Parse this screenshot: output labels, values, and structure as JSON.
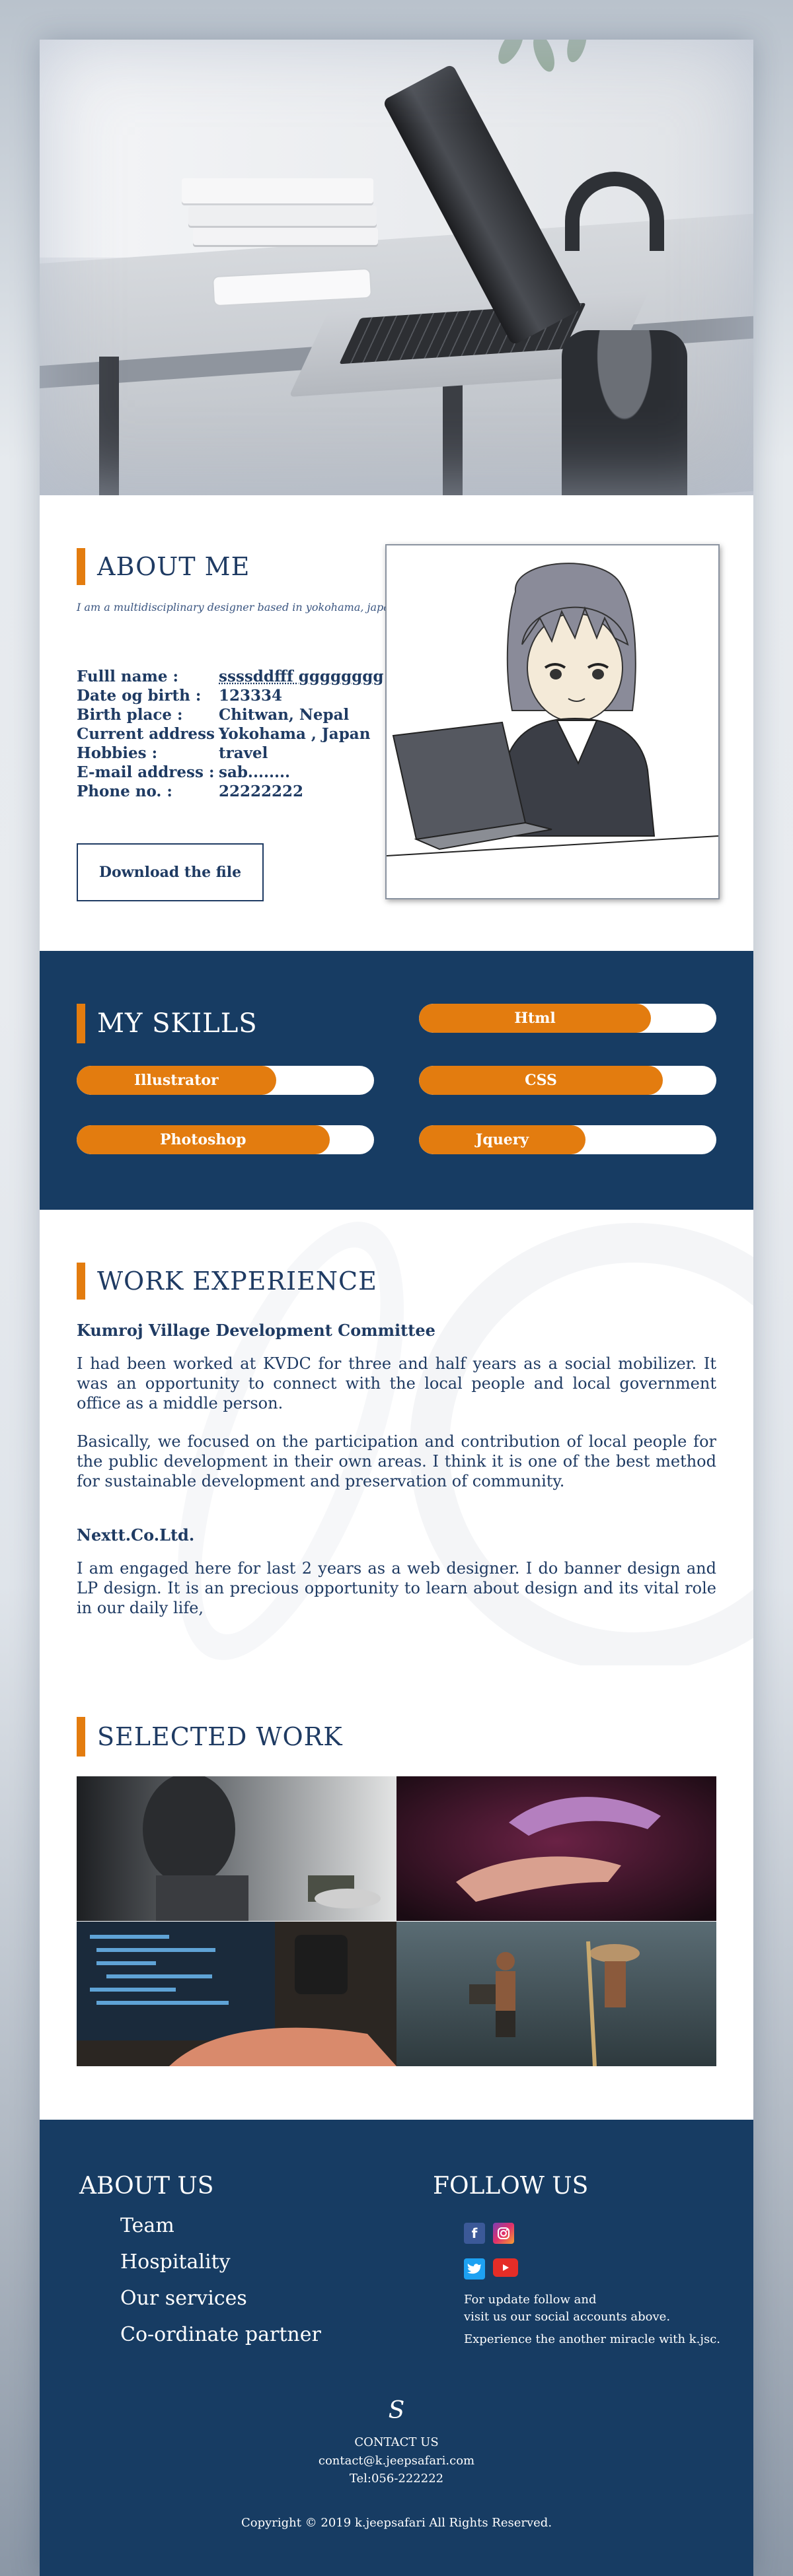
{
  "about": {
    "title": "ABOUT ME",
    "intro": "I am a multidisciplinary designer based in yokohama, japan.",
    "info": [
      {
        "label": "Fulll name :",
        "value": "ssssddfff gggggggg"
      },
      {
        "label": "Date og birth :",
        "value": "123334"
      },
      {
        "label": "Birth place :",
        "value": "Chitwan, Nepal"
      },
      {
        "label": "Current address :",
        "value": "Yokohama , Japan"
      },
      {
        "label": "Hobbies :",
        "value": "travel"
      },
      {
        "label": "E-mail address :",
        "value": "sab........"
      },
      {
        "label": "Phone no. :",
        "value": "22222222"
      }
    ],
    "download_label": "Download the file"
  },
  "skills": {
    "title": "MY SKILLS",
    "items": [
      {
        "name": "Html",
        "level": 0.78
      },
      {
        "name": "Illustrator",
        "level": 0.67
      },
      {
        "name": "CSS",
        "level": 0.82
      },
      {
        "name": "Photoshop",
        "level": 0.85
      },
      {
        "name": "Jquery",
        "level": 0.56
      }
    ]
  },
  "work": {
    "title": "WORK EXPERIENCE",
    "jobs": [
      {
        "company": "Kumroj Village Development Committee",
        "p1": "I had been worked at KVDC for three and half years as a social mobilizer. It was an opportunity to connect with the local people and local government office as a middle person.",
        "p2": "Basically, we focused on the participation and contribution of local people for the public development in their own areas. I think it is one of the best method for sustainable development and preservation of community."
      },
      {
        "company": "Nextt.Co.Ltd.",
        "p1": "I am engaged here for last 2 years as a web designer. I do banner design and LP design. It is an precious opportunity to learn about design and its vital role in our daily life,"
      }
    ]
  },
  "selected": {
    "title": "SELECTED WORK"
  },
  "footer": {
    "about_title": "ABOUT US",
    "links": [
      "Team",
      "Hospitality",
      "Our services",
      "Co-ordinate partner"
    ],
    "follow_title": "FOLLOW US",
    "follow_text_1": "For update follow and",
    "follow_text_2": "visit us our social accounts above.",
    "follow_text_3": "Experience the another miracle with k.jsc.",
    "logo": "S",
    "contact_title": "CONTACT US",
    "contact_email": "contact@k.jeepsafari.com",
    "contact_tel": "Tel:056-222222",
    "copyright": "Copyright © 2019 k.jeepsafari All Rights Reserved."
  },
  "colors": {
    "navy": "#173c63",
    "accent": "#e37c0f",
    "text": "#1f3b63"
  }
}
